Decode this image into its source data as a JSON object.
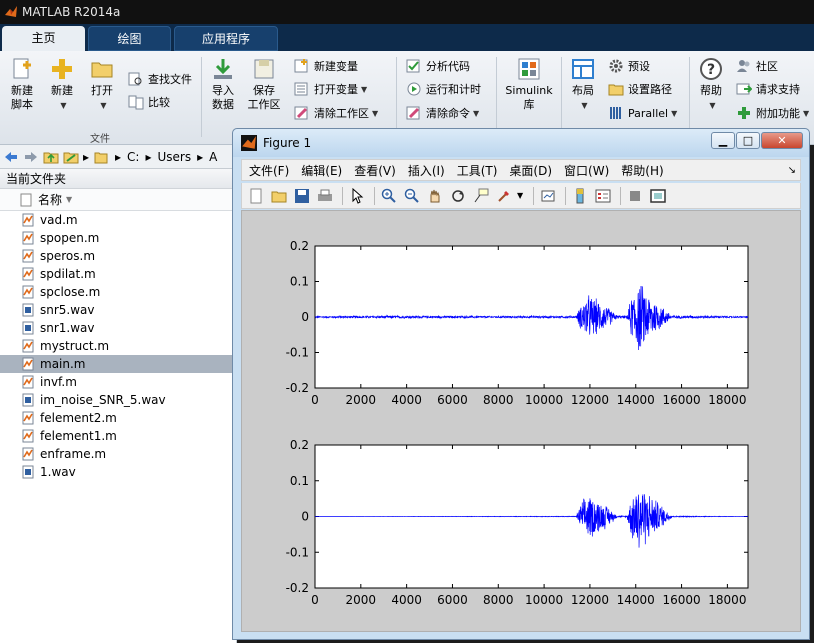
{
  "app": {
    "title": "MATLAB R2014a"
  },
  "tabs": [
    {
      "label": "主页",
      "active": true
    },
    {
      "label": "绘图",
      "active": false
    },
    {
      "label": "应用程序",
      "active": false
    }
  ],
  "ribbon": {
    "new_script": "新建\n脚本",
    "new_script_l1": "新建",
    "new_script_l2": "脚本",
    "new": "新建",
    "open": "打开",
    "find_files": "查找文件",
    "compare": "比较",
    "file_group": "文件",
    "import_l1": "导入",
    "import_l2": "数据",
    "save_ws_l1": "保存",
    "save_ws_l2": "工作区",
    "new_variable": "新建变量",
    "open_variable": "打开变量",
    "clear_workspace": "清除工作区",
    "analyze_code": "分析代码",
    "run_and_time": "运行和计时",
    "clear_commands": "清除命令",
    "simulink_l1": "Simulink",
    "simulink_l2": "库",
    "layout": "布局",
    "preferences": "预设",
    "set_path": "设置路径",
    "parallel": "Parallel",
    "help": "帮助",
    "community": "社区",
    "request_support": "请求支持",
    "addons": "附加功能"
  },
  "address": {
    "crumbs": [
      "C:",
      "Users",
      "A"
    ]
  },
  "folder": {
    "title": "当前文件夹",
    "column_name": "名称",
    "files": [
      {
        "name": "vad.m",
        "type": "m"
      },
      {
        "name": "spopen.m",
        "type": "m"
      },
      {
        "name": "speros.m",
        "type": "m"
      },
      {
        "name": "spdilat.m",
        "type": "m"
      },
      {
        "name": "spclose.m",
        "type": "m"
      },
      {
        "name": "snr5.wav",
        "type": "wav"
      },
      {
        "name": "snr1.wav",
        "type": "wav"
      },
      {
        "name": "mystruct.m",
        "type": "m"
      },
      {
        "name": "main.m",
        "type": "m",
        "selected": true
      },
      {
        "name": "invf.m",
        "type": "m"
      },
      {
        "name": "im_noise_SNR_5.wav",
        "type": "wav"
      },
      {
        "name": "felement2.m",
        "type": "m"
      },
      {
        "name": "felement1.m",
        "type": "m"
      },
      {
        "name": "enframe.m",
        "type": "m"
      },
      {
        "name": "1.wav",
        "type": "wav"
      }
    ]
  },
  "figure": {
    "title": "Figure 1",
    "menu": [
      "文件(F)",
      "编辑(E)",
      "查看(V)",
      "插入(I)",
      "工具(T)",
      "桌面(D)",
      "窗口(W)",
      "帮助(H)"
    ]
  },
  "chart_data": [
    {
      "type": "line",
      "title": "",
      "xlabel": "",
      "ylabel": "",
      "xlim": [
        0,
        18900
      ],
      "ylim": [
        -0.2,
        0.2
      ],
      "xticks": [
        "0",
        "2000",
        "4000",
        "6000",
        "8000",
        "10000",
        "12000",
        "14000",
        "16000",
        "18000"
      ],
      "yticks": [
        "0.2",
        "0.1",
        "0",
        "-0.1",
        "-0.2"
      ],
      "color": "#0000ff",
      "grid": false,
      "series": [
        {
          "envelope": [
            {
              "x": 0,
              "amp": 0.002
            },
            {
              "x": 1000,
              "amp": 0.003
            },
            {
              "x": 4000,
              "amp": 0.004
            },
            {
              "x": 7000,
              "amp": 0.003
            },
            {
              "x": 11400,
              "amp": 0.003
            },
            {
              "x": 11600,
              "amp": 0.04
            },
            {
              "x": 11900,
              "amp": 0.07
            },
            {
              "x": 12300,
              "amp": 0.055
            },
            {
              "x": 12800,
              "amp": 0.03
            },
            {
              "x": 13200,
              "amp": 0.005
            },
            {
              "x": 13600,
              "amp": 0.004
            },
            {
              "x": 13800,
              "amp": 0.06
            },
            {
              "x": 14100,
              "amp": 0.115
            },
            {
              "x": 14600,
              "amp": 0.07
            },
            {
              "x": 15200,
              "amp": 0.03
            },
            {
              "x": 15600,
              "amp": 0.005
            },
            {
              "x": 18900,
              "amp": 0.002
            }
          ]
        }
      ]
    },
    {
      "type": "line",
      "title": "",
      "xlabel": "",
      "ylabel": "",
      "xlim": [
        0,
        18900
      ],
      "ylim": [
        -0.2,
        0.2
      ],
      "xticks": [
        "0",
        "2000",
        "4000",
        "6000",
        "8000",
        "10000",
        "12000",
        "14000",
        "16000",
        "18000"
      ],
      "yticks": [
        "0.2",
        "0.1",
        "0",
        "-0.1",
        "-0.2"
      ],
      "color": "#0000ff",
      "grid": false,
      "series": [
        {
          "envelope": [
            {
              "x": 0,
              "amp": 0.0
            },
            {
              "x": 11400,
              "amp": 0.001
            },
            {
              "x": 11600,
              "amp": 0.04
            },
            {
              "x": 11900,
              "amp": 0.07
            },
            {
              "x": 12300,
              "amp": 0.055
            },
            {
              "x": 12800,
              "amp": 0.03
            },
            {
              "x": 13200,
              "amp": 0.002
            },
            {
              "x": 13600,
              "amp": 0.002
            },
            {
              "x": 13800,
              "amp": 0.06
            },
            {
              "x": 14100,
              "amp": 0.115
            },
            {
              "x": 14600,
              "amp": 0.07
            },
            {
              "x": 15200,
              "amp": 0.03
            },
            {
              "x": 15600,
              "amp": 0.002
            },
            {
              "x": 18900,
              "amp": 0.0
            }
          ]
        }
      ]
    }
  ]
}
